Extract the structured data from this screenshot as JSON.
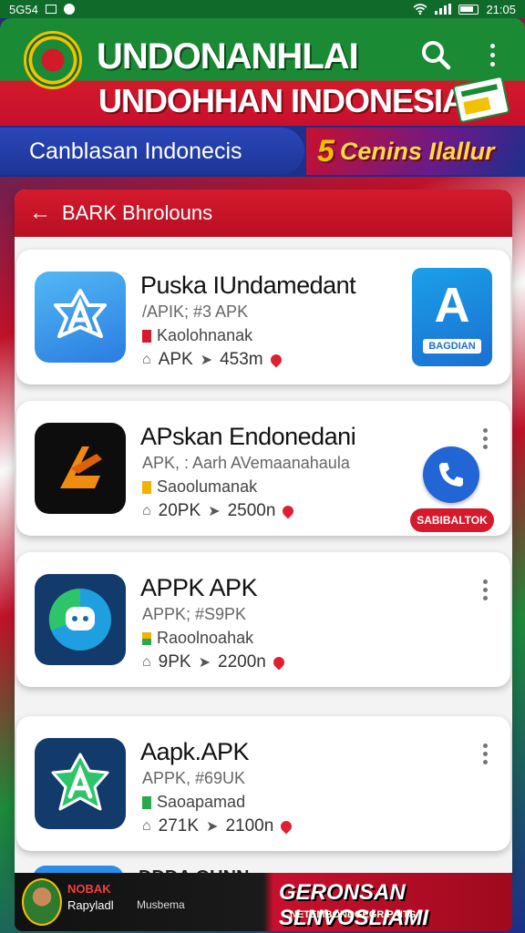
{
  "status_bar": {
    "time_left": "5G54",
    "time_right": "21:05"
  },
  "header": {
    "title_line1": "UNDONANHLAI",
    "title_line2": "UNDOHHAN INDONESIAI"
  },
  "subbar": {
    "pill_text": "Canblasan Indonecis",
    "promo_number": "5",
    "promo_text": "Cenins Ilallur"
  },
  "panel": {
    "title": "BARK Bhrolouns",
    "apps": [
      {
        "name": "Puska IUndamedant",
        "sub": "/APIK; #3 APK",
        "category": "Kaolohnanak",
        "meta1": "APK",
        "meta2": "453m",
        "flag_color": "#d41a2c",
        "side": "BAGDIAN"
      },
      {
        "name": "APskan Endonedani",
        "sub": "APK, : Aarh AVemaanahaula",
        "category": "Saoolumanak",
        "meta1": "20PK",
        "meta2": "2500n",
        "flag_color": "#f2b200",
        "side": "SABIBALTOK"
      },
      {
        "name": "APPK APK",
        "sub": "APPK; #S9PK",
        "category": "Raoolnoahak",
        "meta1": "9PK",
        "meta2": "2200n",
        "flag_color": "#2aa84a"
      },
      {
        "name": "Aapk.APK",
        "sub": "APPK, #69UK",
        "category": "Saoapamad",
        "meta1": "271K",
        "meta2": "2100n",
        "flag_color": "#2aa84a"
      }
    ],
    "peek_text": "DDDA OUNN"
  },
  "bottom_bar": {
    "line1": "NOBAK",
    "line2": "Rapyladl",
    "line2b": "Musbema",
    "right1": "GERONSAN SLNVOSLIAMI",
    "right2": "NETEMBONDGEGR PAITS"
  },
  "colors": {
    "green": "#1b8a35",
    "red": "#c8102e",
    "blue": "#1c2f8c",
    "gold": "#f2c200"
  },
  "icons": [
    "search-icon",
    "more-icon",
    "back-icon",
    "call-icon",
    "location-pin-icon",
    "home-icon",
    "tag-icon"
  ]
}
